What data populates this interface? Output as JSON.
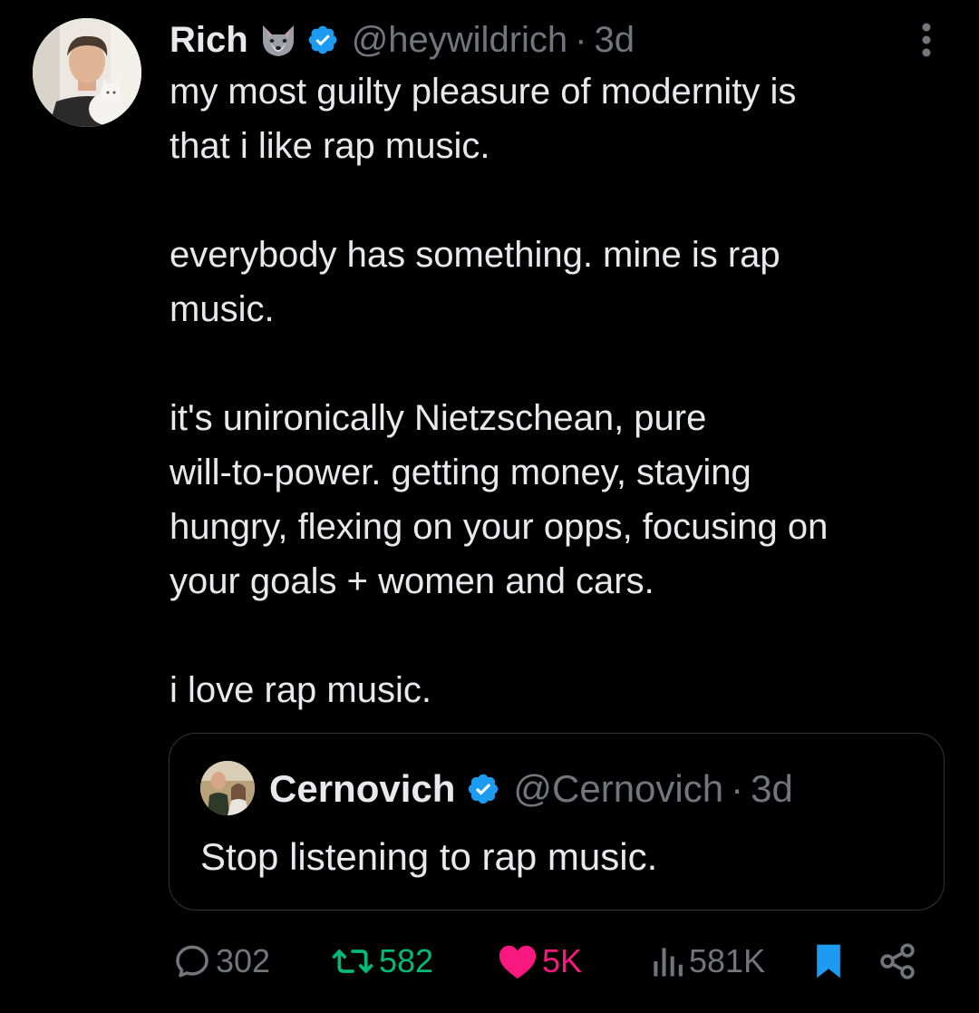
{
  "author": {
    "name": "Rich",
    "emoji_icon": "wolf-face-icon",
    "verified_icon": "verified-badge-icon",
    "handle": "@heywildrich",
    "separator": "·",
    "time": "3d"
  },
  "more_icon": "more-vertical-icon",
  "tweet_paragraphs": [
    "my most guilty pleasure of modernity is\nthat i like rap music.",
    "everybody has something. mine is rap\nmusic.",
    "it's unironically Nietzschean, pure\nwill-to-power. getting money, staying\nhungry, flexing on your opps, focusing on\nyour goals + women and cars.",
    "i love rap music."
  ],
  "quoted_tweet": {
    "name": "Cernovich",
    "verified_icon": "verified-badge-icon",
    "handle": "@Cernovich",
    "separator": "·",
    "time": "3d",
    "text": "Stop listening to rap music."
  },
  "actions": {
    "replies": "302",
    "retweets": "582",
    "likes": "5K",
    "views": "581K",
    "bookmark_icon": "bookmark-filled-icon",
    "share_icon": "share-icon"
  },
  "colors": {
    "background": "#000000",
    "text": "#e7e9ea",
    "muted": "#71767b",
    "verified": "#1d9bf0",
    "retweet": "#00ba7c",
    "like": "#f91880",
    "bookmark": "#1d9bf0",
    "border": "#333639"
  }
}
